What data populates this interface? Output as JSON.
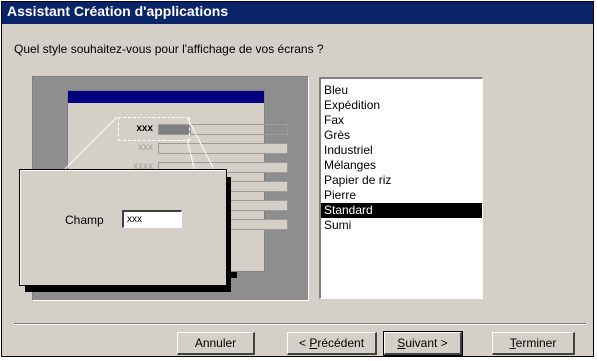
{
  "window": {
    "title": "Assistant Création d'applications"
  },
  "question": "Quel style souhaitez-vous pour l'affichage de vos écrans ?",
  "preview": {
    "rows": [
      "xxx",
      "xxx",
      "xxxx",
      "",
      "",
      ""
    ],
    "zoom_label": "Champ",
    "zoom_field_value": "xxx"
  },
  "styles": {
    "items": [
      "Bleu",
      "Expédition",
      "Fax",
      "Grès",
      "Industriel",
      "Mélanges",
      "Papier de riz",
      "Pierre",
      "Standard",
      "Sumi"
    ],
    "selected": "Standard"
  },
  "buttons": {
    "cancel": "Annuler",
    "previous_prefix": "< ",
    "previous_mnemonic": "P",
    "previous_rest": "récédent",
    "next_mnemonic": "S",
    "next_rest": "uivant >",
    "finish_mnemonic": "T",
    "finish_rest": "erminer"
  }
}
